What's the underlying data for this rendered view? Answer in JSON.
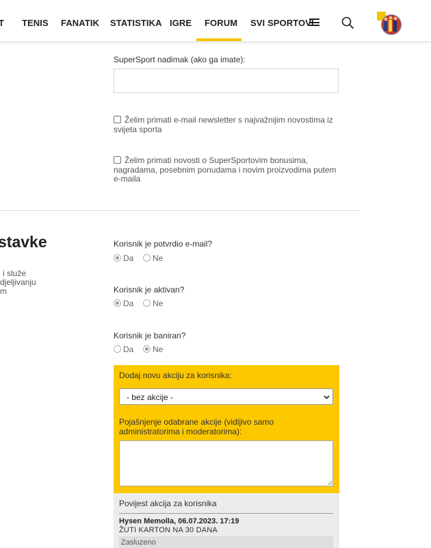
{
  "nav": {
    "items": [
      "T",
      "TENIS",
      "FANATIK",
      "STATISTIKA",
      "IGRE",
      "FORUM",
      "SVI SPORTOVI"
    ],
    "active": "FORUM"
  },
  "form": {
    "nickname_label": "SuperSport nadimak (ako ga imate):",
    "nickname_value": "",
    "newsletter_line1": "Želim primati e-mail newsletter s najvažnijim novostima iz",
    "newsletter_line2": "svijeta sporta",
    "bonus_line1": "Želim primati novosti o SuperSportovim bonusima,",
    "bonus_line2": "nagradama, posebnim ponudama i novim proizvodima putem",
    "bonus_line3": "e-maila"
  },
  "section": {
    "title": "stavke",
    "desc_line1": "i služe",
    "desc_line2": "djeljivanju",
    "desc_line3": "m"
  },
  "settings": {
    "email_confirmed_label": "Korisnik je potvrdio e-mail?",
    "active_label": "Korisnik je aktivan?",
    "banned_label": "Korisnik je baniran?",
    "yes": "Da",
    "no": "Ne",
    "email_confirmed": "Da",
    "active": "Da",
    "banned": "Ne"
  },
  "action": {
    "add_label": "Dodaj novu akciju za korisnika:",
    "select_value": "- bez akcije -",
    "explain_line1": "Pojašnjenje odabrane akcije (vidljivo samo",
    "explain_line2": "administratorima i moderatorima):",
    "explain_value": ""
  },
  "history": {
    "title": "Povijest akcija za korisnika",
    "entries": [
      {
        "author_date": "Hysen Memolla, 06.07.2023. 17:19",
        "action": "ŽUTI KARTON NA 30 DANA",
        "note": "Zasluzeno"
      }
    ]
  },
  "colors": {
    "accent": "#fcc800",
    "nav_underline": "#f4c400",
    "history_bg": "#ececec"
  },
  "icons": {
    "menu": "hamburger-icon",
    "search": "search-icon",
    "avatar": "user-avatar"
  }
}
